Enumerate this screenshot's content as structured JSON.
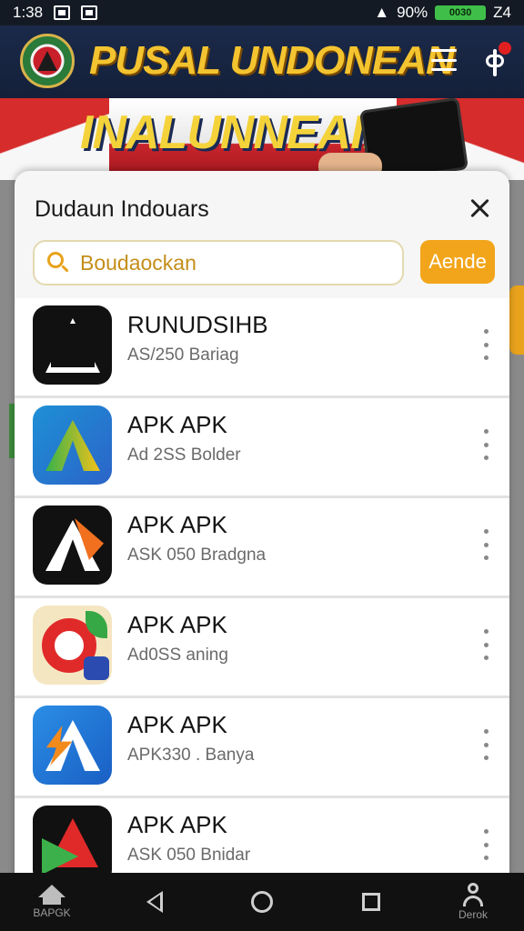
{
  "status_bar": {
    "time": "1:38",
    "battery_percent": "90%",
    "battery_label": "0030",
    "right_text": "Z4"
  },
  "header": {
    "title": "PUSAL UNDONEAN",
    "logo_icon": "emblem-logo",
    "menu_icon": "hamburger-menu-icon",
    "notification_icon": "notification-icon"
  },
  "banner": {
    "text": "INALUNNEAIN"
  },
  "sheet": {
    "title": "Dudaun Indouars",
    "close_icon": "close-icon",
    "search": {
      "value": "Boudaockan",
      "icon": "search-icon"
    },
    "search_button": "Aende",
    "apps": [
      {
        "name": "RUNUDSIHB",
        "meta": "AS/250 Bariag",
        "icon": "black-a-app-icon"
      },
      {
        "name": "APK APK",
        "meta": "Ad 2SS Bolder",
        "icon": "gradient-a-app-icon"
      },
      {
        "name": "APK APK",
        "meta": "ASK 050 Bradgna",
        "icon": "orange-a-app-icon"
      },
      {
        "name": "APK APK",
        "meta": "Ad0SS aning",
        "icon": "red-ring-app-icon"
      },
      {
        "name": "APK APK",
        "meta": "APK330 . Banya",
        "icon": "blue-bolt-app-icon"
      },
      {
        "name": "APK APK",
        "meta": "ASK 050 Bnidar",
        "icon": "red-green-triangle-app-icon"
      }
    ]
  },
  "bottom_nav": {
    "home_label": "BAPGK",
    "profile_label": "Derok"
  },
  "colors": {
    "accent": "#f2a51a",
    "header_bg": "#1b2a4a",
    "title_yellow": "#f4c430"
  }
}
